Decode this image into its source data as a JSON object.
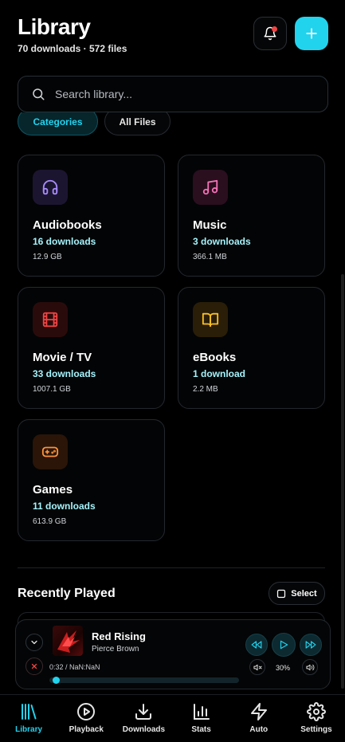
{
  "header": {
    "title": "Library",
    "subtitle": "70 downloads · 572 files"
  },
  "search": {
    "placeholder": "Search library..."
  },
  "tabs": [
    {
      "label": "Categories",
      "active": true
    },
    {
      "label": "All Files",
      "active": false
    }
  ],
  "categories": [
    {
      "name": "Audiobooks",
      "count": "16 downloads",
      "size": "12.9 GB",
      "icon": "headphones-icon",
      "color": "#a78bfa"
    },
    {
      "name": "Music",
      "count": "3 downloads",
      "size": "366.1 MB",
      "icon": "music-icon",
      "color": "#f472b6"
    },
    {
      "name": "Movie / TV",
      "count": "33 downloads",
      "size": "1007.1 GB",
      "icon": "film-icon",
      "color": "#ef4444"
    },
    {
      "name": "eBooks",
      "count": "1 download",
      "size": "2.2 MB",
      "icon": "book-icon",
      "color": "#fbbf24"
    },
    {
      "name": "Games",
      "count": "11 downloads",
      "size": "613.9 GB",
      "icon": "gamepad-icon",
      "color": "#fb923c"
    }
  ],
  "recent": {
    "title": "Recently Played",
    "select_label": "Select"
  },
  "player": {
    "title": "Red Rising",
    "artist": "Pierce Brown",
    "time": "0:32 / NaN:NaN",
    "volume": "30%",
    "progress": 0.02
  },
  "nav": [
    {
      "label": "Library",
      "icon": "library-icon",
      "active": true
    },
    {
      "label": "Playback",
      "icon": "play-circle-icon",
      "active": false
    },
    {
      "label": "Downloads",
      "icon": "download-icon",
      "active": false
    },
    {
      "label": "Stats",
      "icon": "bar-chart-icon",
      "active": false
    },
    {
      "label": "Auto",
      "icon": "lightning-icon",
      "active": false
    },
    {
      "label": "Settings",
      "icon": "gear-icon",
      "active": false
    }
  ],
  "colors": {
    "accent": "#22d3ee",
    "notification_dot": "#ef4444",
    "close": "#ef4444"
  }
}
